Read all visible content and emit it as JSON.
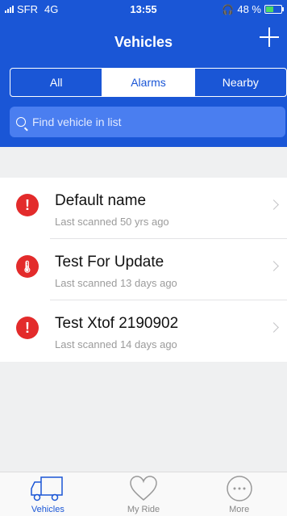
{
  "status_bar": {
    "carrier": "SFR",
    "network": "4G",
    "time": "13:55",
    "battery": "48 %"
  },
  "header": {
    "title": "Vehicles"
  },
  "segments": [
    {
      "label": "All",
      "active": false
    },
    {
      "label": "Alarms",
      "active": true
    },
    {
      "label": "Nearby",
      "active": false
    }
  ],
  "search": {
    "placeholder": "Find vehicle in list"
  },
  "vehicles": [
    {
      "name": "Default name",
      "subtitle": "Last scanned 50 yrs ago",
      "icon": "alert-icon"
    },
    {
      "name": "Test For Update",
      "subtitle": "Last scanned 13 days ago",
      "icon": "temperature-alert-icon"
    },
    {
      "name": "Test Xtof 2190902",
      "subtitle": "Last scanned 14 days ago",
      "icon": "alert-icon"
    }
  ],
  "tabbar": [
    {
      "label": "Vehicles",
      "icon": "truck-icon",
      "active": true
    },
    {
      "label": "My Ride",
      "icon": "heart-icon",
      "active": false
    },
    {
      "label": "More",
      "icon": "more-icon",
      "active": false
    }
  ],
  "colors": {
    "primary": "#1a56d6",
    "alert": "#e32b2b",
    "search_bg": "#4a7ef0"
  }
}
